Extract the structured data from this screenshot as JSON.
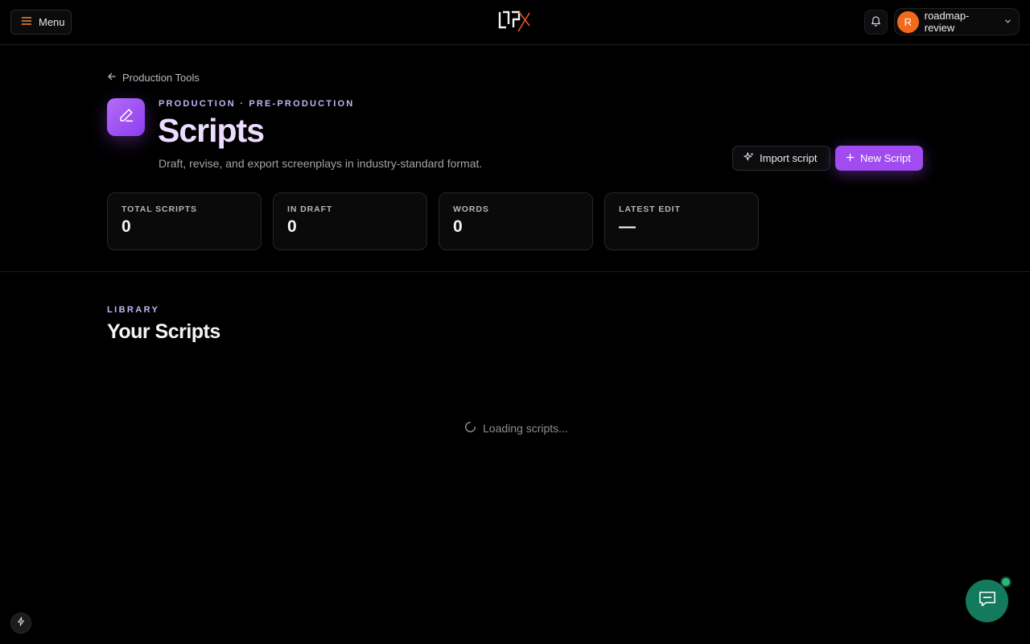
{
  "topbar": {
    "menu_label": "Menu",
    "user": {
      "initial": "R",
      "name": "roadmap-review"
    }
  },
  "header": {
    "back_label": "Production Tools",
    "eyebrow": "PRODUCTION · PRE-PRODUCTION",
    "title": "Scripts",
    "subtitle": "Draft, revise, and export screenplays in industry-standard format.",
    "import_label": "Import script",
    "new_label": "New Script"
  },
  "stats": [
    {
      "label": "TOTAL SCRIPTS",
      "value": "0"
    },
    {
      "label": "IN DRAFT",
      "value": "0"
    },
    {
      "label": "WORDS",
      "value": "0"
    },
    {
      "label": "LATEST EDIT",
      "value": "—"
    }
  ],
  "library": {
    "eyebrow": "LIBRARY",
    "title": "Your Scripts",
    "loading_text": "Loading scripts..."
  },
  "icons": {
    "menu": "hamburger-icon",
    "bell": "bell-icon",
    "chevron": "chevron-down-icon",
    "back": "arrow-left-icon",
    "page": "pencil-icon",
    "import": "sparkles-icon",
    "new": "plus-icon",
    "loading": "spinner-icon",
    "bolt": "bolt-icon",
    "chat": "chat-bubble-icon"
  },
  "colors": {
    "accent": "#a04cf0",
    "avatar": "#f26a1b",
    "chat": "#137a5d",
    "menu_icon": "#f08a3a"
  }
}
